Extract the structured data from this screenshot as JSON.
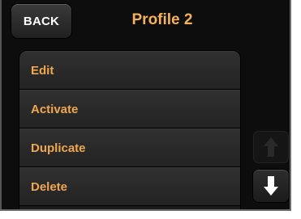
{
  "header": {
    "back_label": "BACK",
    "title": "Profile 2"
  },
  "menu": {
    "items": [
      {
        "label": "Edit"
      },
      {
        "label": "Activate"
      },
      {
        "label": "Duplicate"
      },
      {
        "label": "Delete"
      }
    ]
  },
  "scroll": {
    "up_icon": "arrow-up-icon",
    "down_icon": "arrow-down-icon",
    "up_enabled": false,
    "down_enabled": true
  },
  "colors": {
    "accent": "#f0a74e",
    "title": "#f5b25a",
    "background": "#0d0d0d",
    "button_text": "#ffffff",
    "arrow_active": "#ffffff",
    "arrow_disabled": "#2a2a2a"
  }
}
